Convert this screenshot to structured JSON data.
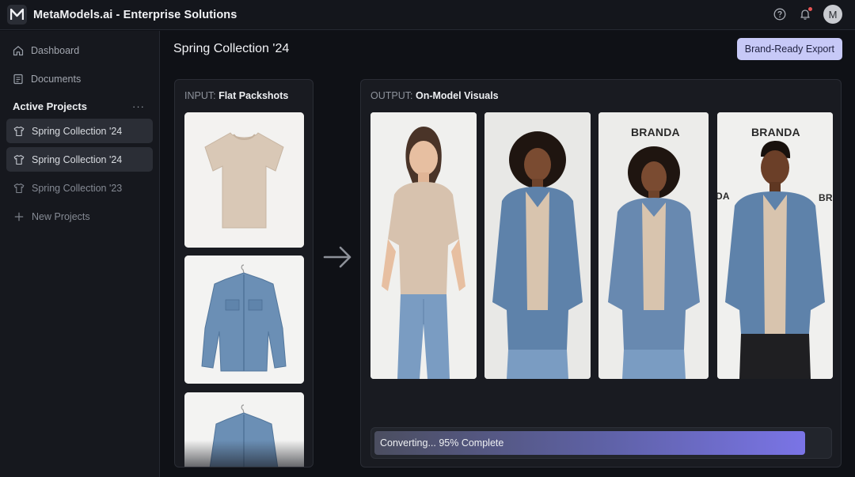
{
  "app": {
    "title": "MetaModels.ai - Enterprise Solutions",
    "avatar_initial": "M"
  },
  "sidebar": {
    "nav": [
      {
        "label": "Dashboard",
        "icon": "home-icon"
      },
      {
        "label": "Documents",
        "icon": "document-icon"
      }
    ],
    "section_title": "Active Projects",
    "more": "···",
    "projects": [
      {
        "label": "Spring Collection '24",
        "state": "active"
      },
      {
        "label": "Spring Collection '24",
        "state": "active"
      },
      {
        "label": "Spring Collection '23",
        "state": "muted"
      }
    ],
    "new_project": "New Projects"
  },
  "main": {
    "title": "Spring Collection '24",
    "export_label": "Brand-Ready Export",
    "input_panel": {
      "prefix": "INPUT:",
      "title": "Flat Packshots"
    },
    "output_panel": {
      "prefix": "OUTPUT:",
      "title": "On-Model Visuals"
    },
    "brand_text": "BRANDA",
    "brand_fragment_left": "DA",
    "brand_fragment_right": "BR",
    "progress": {
      "label": "Converting... 95% Complete",
      "value": 95
    }
  },
  "colors": {
    "accent": "#c7c9f7",
    "progress_end": "#7a74e6",
    "notification": "#e85454"
  }
}
